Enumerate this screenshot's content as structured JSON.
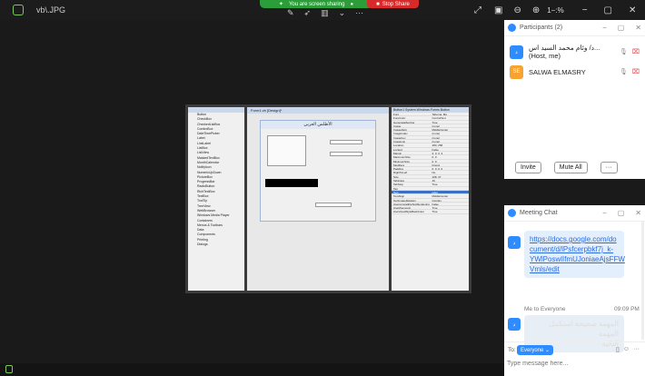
{
  "topbar": {
    "file_name": "vb\\.JPG",
    "sharing_text": "You are screen sharing",
    "stop_share_label": "Stop Share",
    "zoom_text": "1−:%"
  },
  "participants": {
    "title": "Participants (2)",
    "list": [
      {
        "avatar_text": "د",
        "avatar_color": "#2d8cff",
        "name": "د/ وئام محمد السيد اس... (Host, me)"
      },
      {
        "avatar_text": "SE",
        "avatar_color": "#f7a231",
        "name": "SALWA ELMASRY"
      }
    ],
    "invite_label": "Invite",
    "mute_all_label": "Mute All",
    "more_label": "···"
  },
  "chat": {
    "title": "Meeting Chat",
    "link_text": "https://docs.google.com/document/d/lPsfcerpbkf7j_k-YWlPoswlIfmUJoniaeAjsFFWVmls/edit",
    "link_lines": [
      "https://docs.google.com/do",
      "cument/d/lPsfcerpbkf7j_k-",
      "YWlPoswlIfmUJoniaeAjsFFW",
      "Vmls/edit"
    ],
    "message_meta": "Me to Everyone",
    "message_time": "09:09 PM",
    "message_lines": [
      "المهمة صحيحة استكمل المهمة",
      "التالية"
    ],
    "avatar_text": "د",
    "to_label": "To:",
    "to_value": "Everyone ⌄",
    "input_placeholder": "Type message here..."
  },
  "vs_window": {
    "designer_tab": "Form1.vb [Design]*",
    "form_title": "الأطلس العربي",
    "properties_title": "Button1 System.Windows.Forms.Button",
    "toolbox_items": [
      "Button",
      "CheckBox",
      "CheckedListBox",
      "ComboBox",
      "DateTimePicker",
      "Label",
      "LinkLabel",
      "ListBox",
      "ListView",
      "MaskedTextBox",
      "MonthCalendar",
      "NotifyIcon",
      "NumericUpDown",
      "PictureBox",
      "ProgressBar",
      "RadioButton",
      "RichTextBox",
      "TextBox",
      "ToolTip",
      "TreeView",
      "WebBrowser",
      "Windows Media Player",
      "Containers",
      "Menus & Toolbars",
      "Data",
      "Components",
      "Printing",
      "Dialogs"
    ],
    "props_rows": [
      [
        "Font",
        "Tahoma, 8pt"
      ],
      [
        "ForeColor",
        "ControlText"
      ],
      [
        "GenerateMember",
        "True"
      ],
      [
        "Image",
        "(none)"
      ],
      [
        "ImageAlign",
        "MiddleCenter"
      ],
      [
        "ImageIndex",
        "(none)"
      ],
      [
        "ImageKey",
        "(none)"
      ],
      [
        "ImageList",
        "(none)"
      ],
      [
        "Location",
        "183, 258"
      ],
      [
        "Locked",
        "False"
      ],
      [
        "Margin",
        "3, 3, 3, 3"
      ],
      [
        "MaximumSize",
        "0, 0"
      ],
      [
        "MinimumSize",
        "0, 0"
      ],
      [
        "Modifiers",
        "Friend"
      ],
      [
        "Padding",
        "0, 0, 0, 0"
      ],
      [
        "RightToLeft",
        "No"
      ],
      [
        "Size",
        "108, 37"
      ],
      [
        "TabIndex",
        "16"
      ],
      [
        "TabStop",
        "True"
      ],
      [
        "Tag",
        ""
      ],
      [
        "Text",
        "jabor"
      ],
      [
        "TextAlign",
        "MiddleCenter"
      ],
      [
        "TextImageRelation",
        "Overlay"
      ],
      [
        "UseCompatibleTextRendering",
        "False"
      ],
      [
        "UseMnemonic",
        "True"
      ],
      [
        "UseVisualStyleBackColor",
        "True"
      ]
    ]
  }
}
